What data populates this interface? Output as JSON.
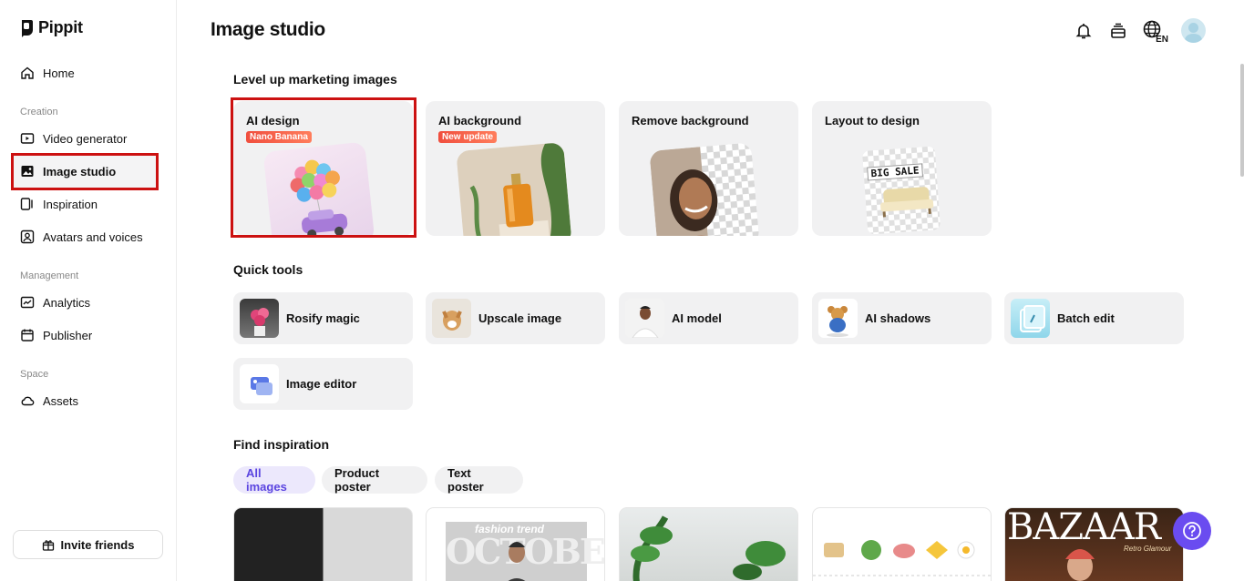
{
  "app": {
    "name": "Pippit"
  },
  "header": {
    "title": "Image studio",
    "language": "EN"
  },
  "sidebar": {
    "home": "Home",
    "sections": {
      "creation": "Creation",
      "management": "Management",
      "space": "Space"
    },
    "items": {
      "video_generator": "Video generator",
      "image_studio": "Image studio",
      "inspiration": "Inspiration",
      "avatars": "Avatars and voices",
      "analytics": "Analytics",
      "publisher": "Publisher",
      "assets": "Assets"
    },
    "invite": "Invite friends"
  },
  "marketing": {
    "title": "Level up marketing images",
    "cards": [
      {
        "label": "AI design",
        "badge": "Nano Banana"
      },
      {
        "label": "AI background",
        "badge": "New update"
      },
      {
        "label": "Remove background"
      },
      {
        "label": "Layout to design",
        "art_text": "BIG SALE"
      }
    ]
  },
  "quick_tools": {
    "title": "Quick tools",
    "items": [
      "Rosify magic",
      "Upscale image",
      "AI model",
      "AI shadows",
      "Batch edit",
      "Image editor"
    ]
  },
  "inspiration": {
    "title": "Find inspiration",
    "filters": [
      "All images",
      "Product poster",
      "Text poster"
    ],
    "active_filter": "All images",
    "thumb_texts": {
      "fashion": "fashion trend",
      "october": "OCTOBER",
      "magazine": "BAZAAR",
      "magazine_sub": "Retro Glamour"
    }
  },
  "colors": {
    "accent": "#6a4cf0",
    "highlight": "#cc1111",
    "badge": "#f04e3e"
  }
}
